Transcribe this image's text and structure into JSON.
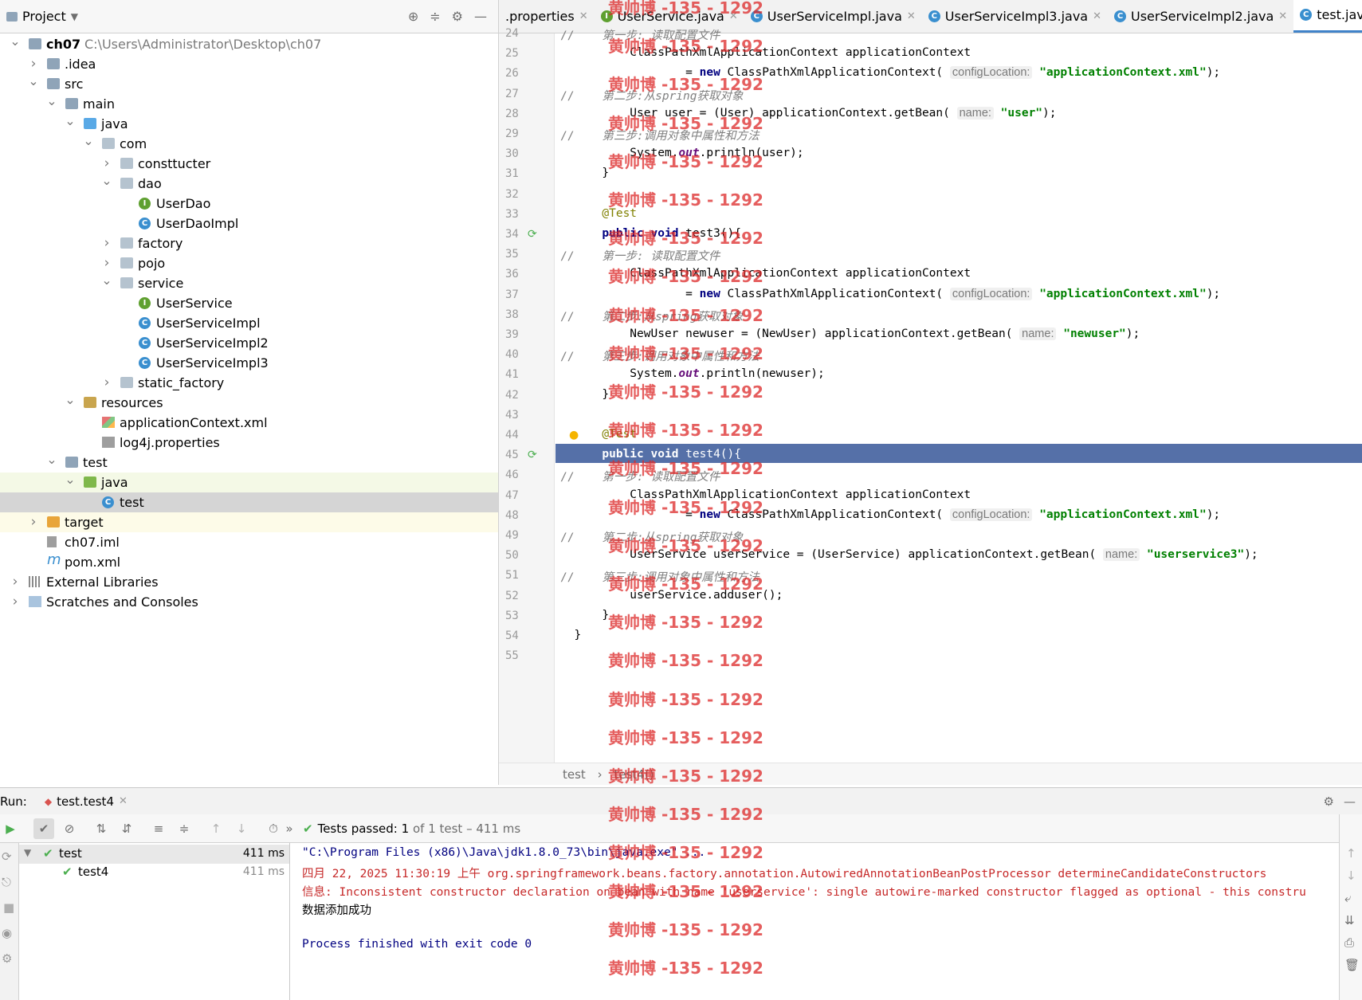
{
  "project_panel": {
    "title": "Project",
    "tree": [
      {
        "label": "ch07",
        "path": "C:\\Users\\Administrator\\Desktop\\ch07",
        "depth": 0,
        "type": "module",
        "expanded": true
      },
      {
        "label": ".idea",
        "depth": 1,
        "type": "folder",
        "expanded": false
      },
      {
        "label": "src",
        "depth": 1,
        "type": "folder",
        "expanded": true
      },
      {
        "label": "main",
        "depth": 2,
        "type": "folder",
        "expanded": true
      },
      {
        "label": "java",
        "depth": 3,
        "type": "folder-blue",
        "expanded": true
      },
      {
        "label": "com",
        "depth": 4,
        "type": "package",
        "expanded": true
      },
      {
        "label": "consttucter",
        "depth": 5,
        "type": "package",
        "expanded": false
      },
      {
        "label": "dao",
        "depth": 5,
        "type": "package",
        "expanded": true
      },
      {
        "label": "UserDao",
        "depth": 6,
        "type": "interface"
      },
      {
        "label": "UserDaoImpl",
        "depth": 6,
        "type": "class"
      },
      {
        "label": "factory",
        "depth": 5,
        "type": "package",
        "expanded": false
      },
      {
        "label": "pojo",
        "depth": 5,
        "type": "package",
        "expanded": false
      },
      {
        "label": "service",
        "depth": 5,
        "type": "package",
        "expanded": true
      },
      {
        "label": "UserService",
        "depth": 6,
        "type": "interface"
      },
      {
        "label": "UserServiceImpl",
        "depth": 6,
        "type": "class"
      },
      {
        "label": "UserServiceImpl2",
        "depth": 6,
        "type": "class"
      },
      {
        "label": "UserServiceImpl3",
        "depth": 6,
        "type": "class"
      },
      {
        "label": "static_factory",
        "depth": 5,
        "type": "package",
        "expanded": false
      },
      {
        "label": "resources",
        "depth": 3,
        "type": "folder-res",
        "expanded": true
      },
      {
        "label": "applicationContext.xml",
        "depth": 4,
        "type": "file-xml"
      },
      {
        "label": "log4j.properties",
        "depth": 4,
        "type": "file-props"
      },
      {
        "label": "test",
        "depth": 2,
        "type": "folder",
        "expanded": true
      },
      {
        "label": "java",
        "depth": 3,
        "type": "folder-green",
        "expanded": true,
        "highlight": "green"
      },
      {
        "label": "test",
        "depth": 4,
        "type": "class",
        "highlight": "gray"
      },
      {
        "label": "target",
        "depth": 1,
        "type": "folder-orange",
        "expanded": false,
        "highlight": "yellow"
      },
      {
        "label": "ch07.iml",
        "depth": 1,
        "type": "file-iml"
      },
      {
        "label": "pom.xml",
        "depth": 1,
        "type": "file-maven"
      },
      {
        "label": "External Libraries",
        "depth": 0,
        "type": "libs",
        "expanded": false
      },
      {
        "label": "Scratches and Consoles",
        "depth": 0,
        "type": "scratch",
        "expanded": false
      }
    ]
  },
  "tabs": [
    {
      "label": ".properties",
      "icon": "none",
      "active": false
    },
    {
      "label": "UserService.java",
      "icon": "interface",
      "active": false
    },
    {
      "label": "UserServiceImpl.java",
      "icon": "class",
      "active": false
    },
    {
      "label": "UserServiceImpl3.java",
      "icon": "class",
      "active": false
    },
    {
      "label": "UserServiceImpl2.java",
      "icon": "class",
      "active": false
    },
    {
      "label": "test.java",
      "icon": "class",
      "active": true
    }
  ],
  "editor": {
    "line_numbers": [
      "24",
      "25",
      "26",
      "27",
      "28",
      "29",
      "30",
      "31",
      "32",
      "33",
      "34",
      "35",
      "36",
      "37",
      "38",
      "39",
      "40",
      "41",
      "42",
      "43",
      "44",
      "45",
      "46",
      "47",
      "48",
      "49",
      "50",
      "51",
      "52",
      "53",
      "54",
      "55"
    ],
    "current_line": "45",
    "breadcrumb": [
      "test",
      "test4()"
    ]
  },
  "run": {
    "label": "Run:",
    "tab": "test.test4",
    "status_prefix": "Tests passed:",
    "status_count": "1",
    "status_rest": "of 1 test – 411 ms",
    "tests": [
      {
        "name": "test",
        "time": "411 ms"
      },
      {
        "name": "test4",
        "time": "411 ms"
      }
    ],
    "console": [
      "\"C:\\Program Files (x86)\\Java\\jdk1.8.0_73\\bin\\java.exe\" ...",
      "四月 22, 2025 11:30:19 上午 org.springframework.beans.factory.annotation.AutowiredAnnotationBeanPostProcessor determineCandidateConstructors",
      "信息: Inconsistent constructor declaration on bean with name 'userservice': single autowire-marked constructor flagged as optional - this constru",
      "数据添加成功",
      "",
      "Process finished with exit code 0"
    ]
  },
  "watermark": "黄帅博 -135 - 1292"
}
